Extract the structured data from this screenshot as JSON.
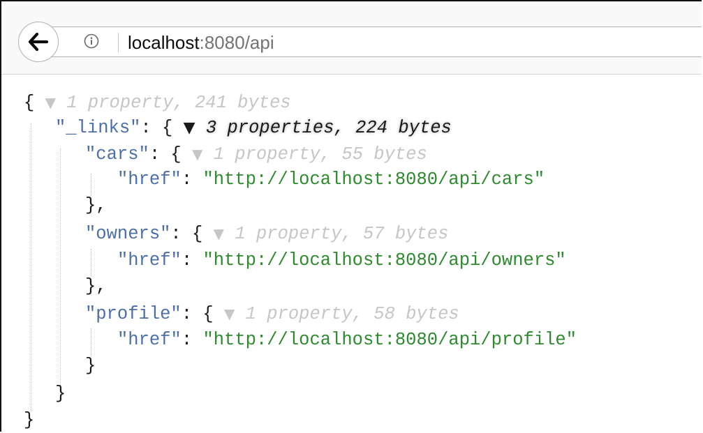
{
  "browser": {
    "url_host": "localhost",
    "url_path": ":8080/api"
  },
  "json_view": {
    "root_open": "{",
    "root_meta": "1 property, 241 bytes",
    "links_key": "\"_links\"",
    "links_colon": ": {",
    "links_meta": "3 properties, 224 bytes",
    "cars_key": "\"cars\"",
    "cars_colon": ": {",
    "cars_meta": "1 property, 55 bytes",
    "cars_href_key": "\"href\"",
    "cars_href_colon": ": ",
    "cars_href_value": "\"http://localhost:8080/api/cars\"",
    "cars_close": "},",
    "owners_key": "\"owners\"",
    "owners_colon": ": {",
    "owners_meta": "1 property, 57 bytes",
    "owners_href_key": "\"href\"",
    "owners_href_colon": ": ",
    "owners_href_value": "\"http://localhost:8080/api/owners\"",
    "owners_close": "},",
    "profile_key": "\"profile\"",
    "profile_colon": ": {",
    "profile_meta": "1 property, 58 bytes",
    "profile_href_key": "\"href\"",
    "profile_href_colon": ": ",
    "profile_href_value": "\"http://localhost:8080/api/profile\"",
    "profile_close": "}",
    "links_close": "}",
    "root_close": "}"
  }
}
